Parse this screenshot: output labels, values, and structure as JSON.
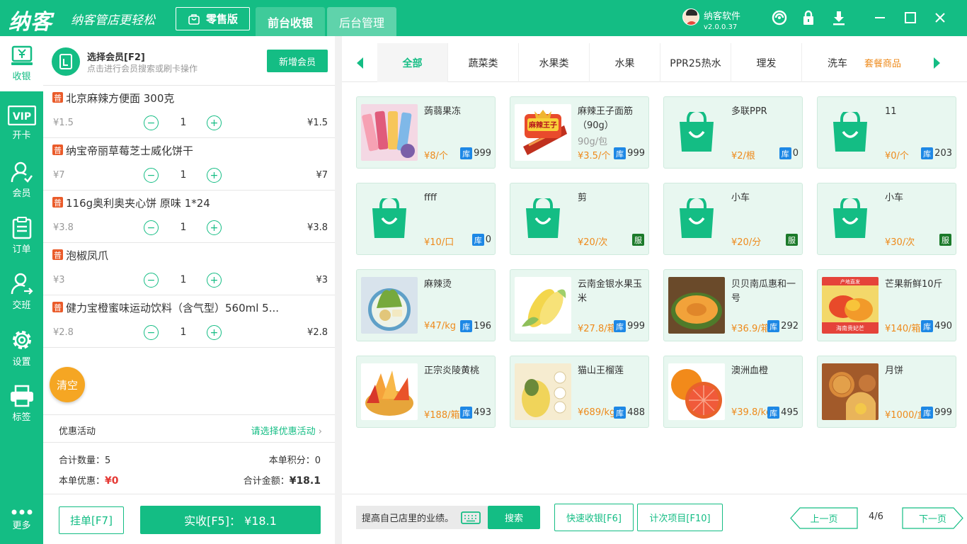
{
  "app": {
    "logo": "纳客",
    "slogan": "纳客管店更轻松",
    "edition": "零售版",
    "tabs": [
      "前台收银",
      "后台管理"
    ],
    "user_name": "纳客软件",
    "version": "v2.0.0.37"
  },
  "sidebar": [
    {
      "label": "收银",
      "icon": "cashier-icon",
      "active": true
    },
    {
      "label": "开卡",
      "icon": "vip-card-icon"
    },
    {
      "label": "会员",
      "icon": "member-icon"
    },
    {
      "label": "订单",
      "icon": "order-icon"
    },
    {
      "label": "交班",
      "icon": "shift-icon"
    },
    {
      "label": "设置",
      "icon": "settings-icon"
    },
    {
      "label": "标签",
      "icon": "printer-icon"
    },
    {
      "label": "更多",
      "icon": "more-icon"
    }
  ],
  "member": {
    "title": "选择会员[F2]",
    "subtitle": "点击进行会员搜索或刷卡操作",
    "new_button": "新增会员"
  },
  "cart": [
    {
      "badge": "普",
      "name": "北京麻辣方便面 300克",
      "price": "¥1.5",
      "qty": "1",
      "total": "¥1.5"
    },
    {
      "badge": "普",
      "name": "纳宝帝丽草莓芝士威化饼干",
      "price": "¥7",
      "qty": "1",
      "total": "¥7"
    },
    {
      "badge": "普",
      "name": "116g奥利奥夹心饼 原味 1*24",
      "price": "¥3.8",
      "qty": "1",
      "total": "¥3.8"
    },
    {
      "badge": "普",
      "name": "泡椒凤爪",
      "price": "¥3",
      "qty": "1",
      "total": "¥3"
    },
    {
      "badge": "普",
      "name": "健力宝橙蜜味运动饮料（含气型）560ml 5...",
      "price": "¥2.8",
      "qty": "1",
      "total": "¥2.8"
    }
  ],
  "clear_label": "清空",
  "promo": {
    "label": "优惠活动",
    "action": "请选择优惠活动"
  },
  "summary": {
    "qty_label": "合计数量：",
    "qty_value": "5",
    "points_label": "本单积分：",
    "points_value": "0",
    "discount_label": "本单优惠：",
    "discount_value": "¥0",
    "amount_label": "合计金额：",
    "amount_value": "¥18.1"
  },
  "hold_button": "挂单[F7]",
  "pay_button": "实收[F5]：  ¥18.1",
  "categories": [
    "全部",
    "蔬菜类",
    "水果类",
    "水果",
    "PPR25热水",
    "理发",
    "洗车"
  ],
  "category_extra": "套餐商品",
  "products": [
    {
      "name": "蒟蒻果冻",
      "sub": "",
      "price": "¥8/个",
      "stock": "999",
      "tag": "库",
      "img": "jelly"
    },
    {
      "name": "麻辣王子面筋（90g）",
      "sub": "90g/包",
      "price": "¥3.5/个",
      "stock": "999",
      "tag": "库",
      "img": "spicy"
    },
    {
      "name": "多联PPR",
      "sub": "",
      "price": "¥2/根",
      "stock": "0",
      "tag": "库",
      "img": "bag"
    },
    {
      "name": "11",
      "sub": "",
      "price": "¥0/个",
      "stock": "203",
      "tag": "库",
      "img": "bag"
    },
    {
      "name": "ffff",
      "sub": "",
      "price": "¥10/口",
      "stock": "0",
      "tag": "库",
      "img": "bag"
    },
    {
      "name": "剪",
      "sub": "",
      "price": "¥20/次",
      "stock": "",
      "tag": "服",
      "img": "bag"
    },
    {
      "name": "小车",
      "sub": "",
      "price": "¥20/分",
      "stock": "",
      "tag": "服",
      "img": "bag"
    },
    {
      "name": "小车",
      "sub": "",
      "price": "¥30/次",
      "stock": "",
      "tag": "服",
      "img": "bag"
    },
    {
      "name": "麻辣烫",
      "sub": "",
      "price": "¥47/kg",
      "stock": "196",
      "tag": "库",
      "img": "malatang"
    },
    {
      "name": "云南金银水果玉米",
      "sub": "",
      "price": "¥27.8/箱",
      "stock": "999",
      "tag": "库",
      "img": "corn"
    },
    {
      "name": "贝贝南瓜惠和一号",
      "sub": "",
      "price": "¥36.9/箱",
      "stock": "292",
      "tag": "库",
      "img": "pumpkin"
    },
    {
      "name": "芒果新鲜10斤",
      "sub": "",
      "price": "¥140/箱",
      "stock": "490",
      "tag": "库",
      "img": "mango"
    },
    {
      "name": "正宗炎陵黄桃",
      "sub": "",
      "price": "¥188/箱",
      "stock": "493",
      "tag": "库",
      "img": "peach"
    },
    {
      "name": "猫山王榴莲",
      "sub": "",
      "price": "¥689/kg",
      "stock": "488",
      "tag": "库",
      "img": "durian"
    },
    {
      "name": "澳洲血橙",
      "sub": "",
      "price": "¥39.8/kg",
      "stock": "495",
      "tag": "库",
      "img": "orange"
    },
    {
      "name": "月饼",
      "sub": "",
      "price": "¥1000/盒",
      "stock": "999",
      "tag": "库",
      "img": "mooncake"
    }
  ],
  "bottom": {
    "search_value": "提高自己店里的业绩。",
    "search_button": "搜索",
    "quick_pay": "快速收银[F6]",
    "count_items": "计次项目[F10]",
    "prev": "上一页",
    "page": "4/6",
    "next": "下一页"
  },
  "colors": {
    "primary": "#14bd84",
    "orange": "#ee8a1b",
    "red": "#e53935",
    "card_bg": "#e8f7f0"
  }
}
